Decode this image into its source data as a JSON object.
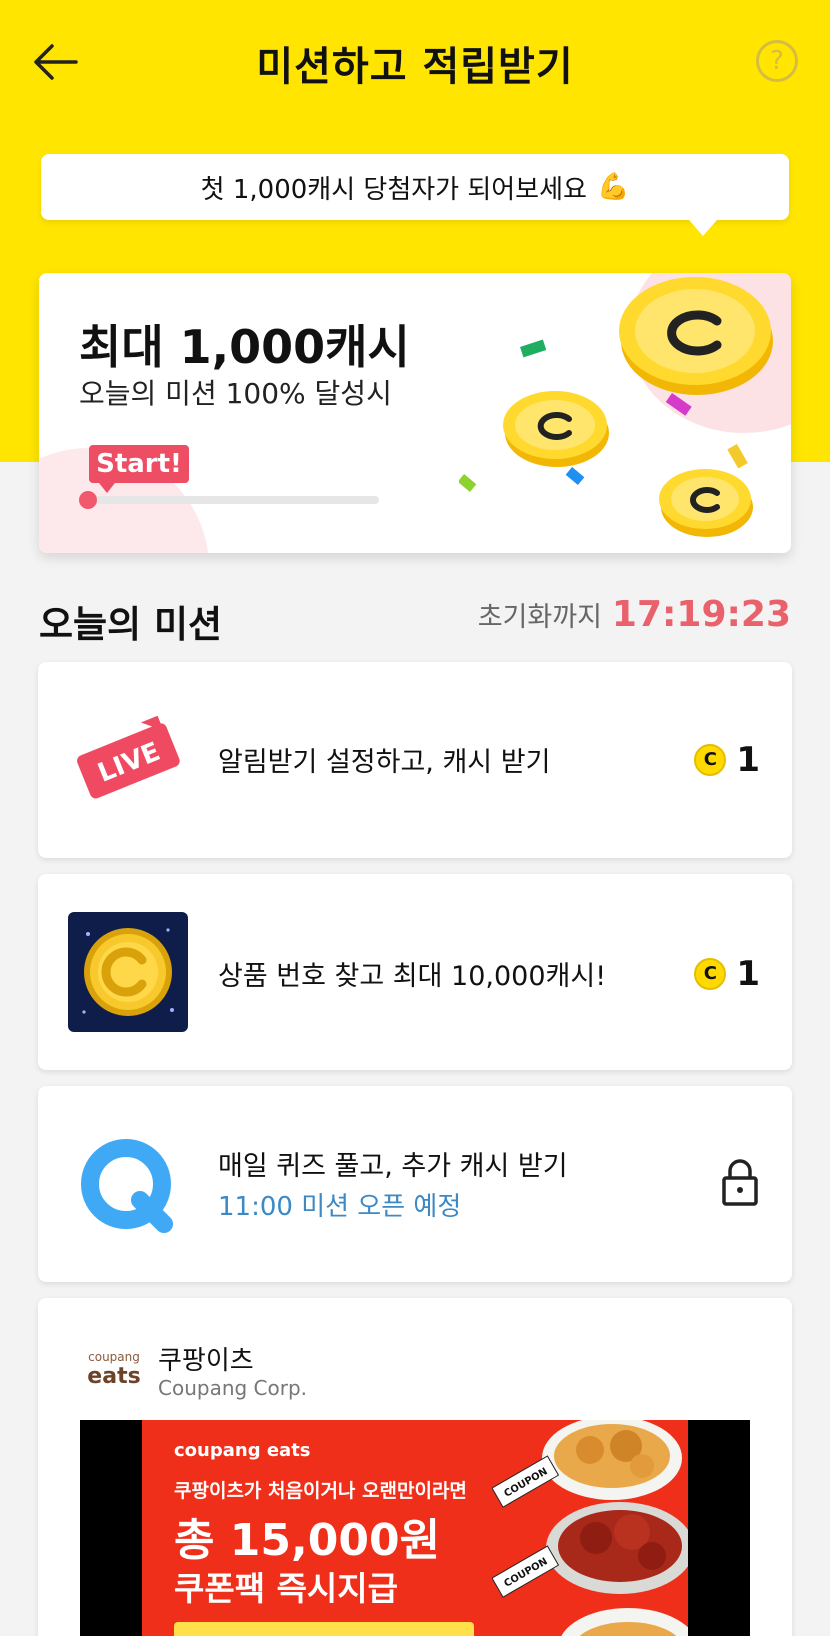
{
  "header": {
    "title": "미션하고 적립받기",
    "back_icon": "arrow-left-icon",
    "help_label": "?"
  },
  "bubble": {
    "text": "첫 1,000캐시 당첨자가 되어보세요",
    "emoji": "💪"
  },
  "reward": {
    "max_label": "최대 1,000캐시",
    "condition": "오늘의 미션 100% 달성시",
    "start_label": "Start!",
    "progress_percent": 0
  },
  "missions_section": {
    "title": "오늘의 미션",
    "reset_label": "초기화까지",
    "reset_time": "17:19:23"
  },
  "missions": [
    {
      "icon": "live-badge-icon",
      "text": "알림받기 설정하고, 캐시 받기",
      "reward_coin": "C",
      "reward": "1"
    },
    {
      "icon": "gold-coin-icon",
      "text": "상품 번호 찾고 최대 10,000캐시!",
      "reward_coin": "C",
      "reward": "1"
    },
    {
      "icon": "quiz-q-icon",
      "text": "매일 퀴즈 풀고, 추가 캐시 받기",
      "sub": "11:00 미션 오픈 예정",
      "locked": true
    }
  ],
  "ad": {
    "logo_top": "coupang",
    "logo_bottom": "eats",
    "name": "쿠팡이츠",
    "company": "Coupang Corp.",
    "banner_brand": "coupang eats",
    "banner_line1": "쿠팡이츠가 처음이거나 오랜만이라면",
    "banner_line2": "총 15,000원",
    "banner_line3": "쿠폰팩 즉시지급",
    "coupon_label": "COUPON"
  },
  "colors": {
    "hero_yellow": "#ffe500",
    "accent_red": "#ee4e63",
    "timer_red": "#e8616b",
    "sub_blue": "#3c89c5",
    "quiz_blue": "#3fa9f5"
  }
}
